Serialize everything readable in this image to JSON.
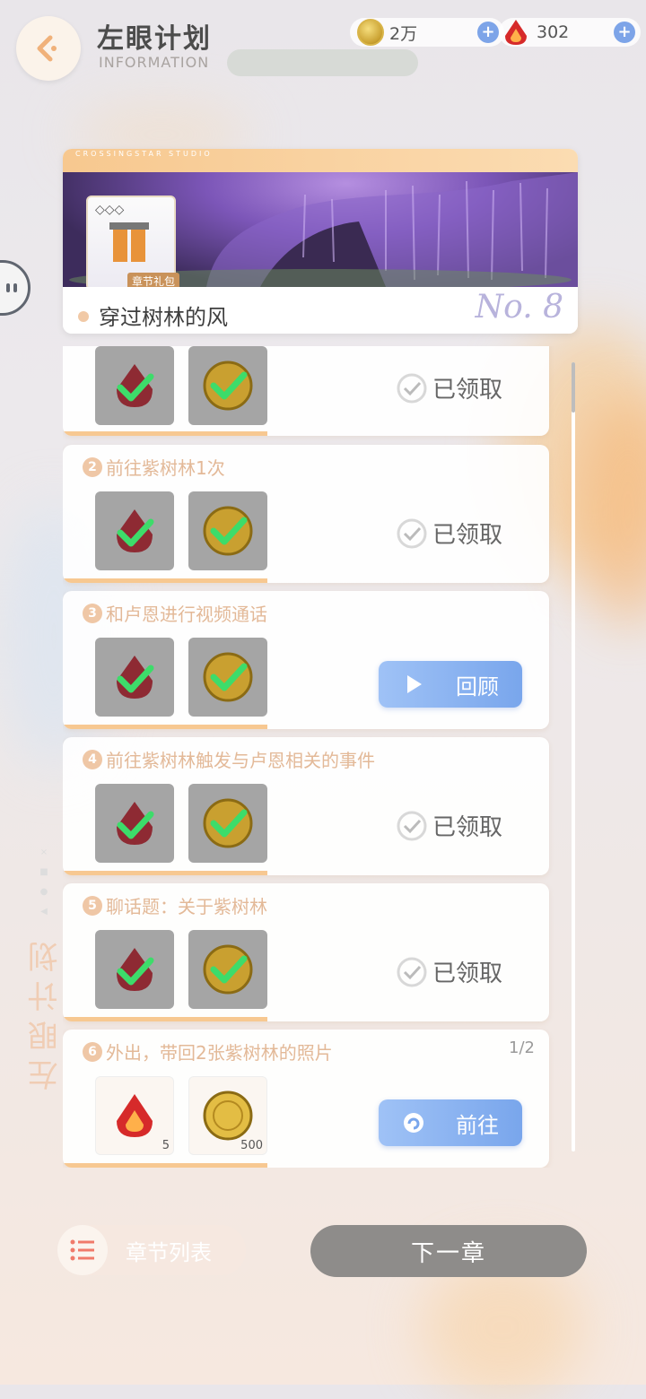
{
  "header": {
    "title": "左眼计划",
    "subtitle": "INFORMATION",
    "back_icon": "back-arrow-icon",
    "blur_pill": {
      "left": "",
      "right": ""
    }
  },
  "currency": {
    "coin": {
      "value": "2万",
      "icon": "gold-coin-icon"
    },
    "gem": {
      "value": "302",
      "icon": "red-crystal-icon"
    }
  },
  "banner": {
    "studio_text": "CROSSINGSTAR STUDIO",
    "title": "穿过树林的风",
    "number": "No. 8",
    "card_label": "章节礼包"
  },
  "tasks": [
    {
      "index": "",
      "label": "",
      "progress": "",
      "status": "已领取",
      "claimed": true
    },
    {
      "index": "2",
      "label": "前往紫树林1次",
      "progress": "",
      "status": "已领取",
      "claimed": true
    },
    {
      "index": "3",
      "label": "和卢恩进行视频通话",
      "progress": "",
      "button": "回顾",
      "claimed": true
    },
    {
      "index": "4",
      "label": "前往紫树林触发与卢恩相关的事件",
      "progress": "",
      "status": "已领取",
      "claimed": true
    },
    {
      "index": "5",
      "label": "聊话题：关于紫树林",
      "progress": "",
      "status": "已领取",
      "claimed": true
    },
    {
      "index": "6",
      "label": "外出，带回2张紫树林的照片",
      "progress": "1/2",
      "button": "前往",
      "claimed": false,
      "reward_counts": {
        "gem": "5",
        "coin": "500"
      }
    }
  ],
  "side": {
    "vertical_text": "左眼计划"
  },
  "footer": {
    "chapter_list": "章节列表",
    "next_chapter": "下一章"
  },
  "colors": {
    "accent_orange": "#f7c891",
    "button_blue": "#79a6ec",
    "check_green": "#3ddc6a",
    "next_btn": "#8e8c8a"
  }
}
